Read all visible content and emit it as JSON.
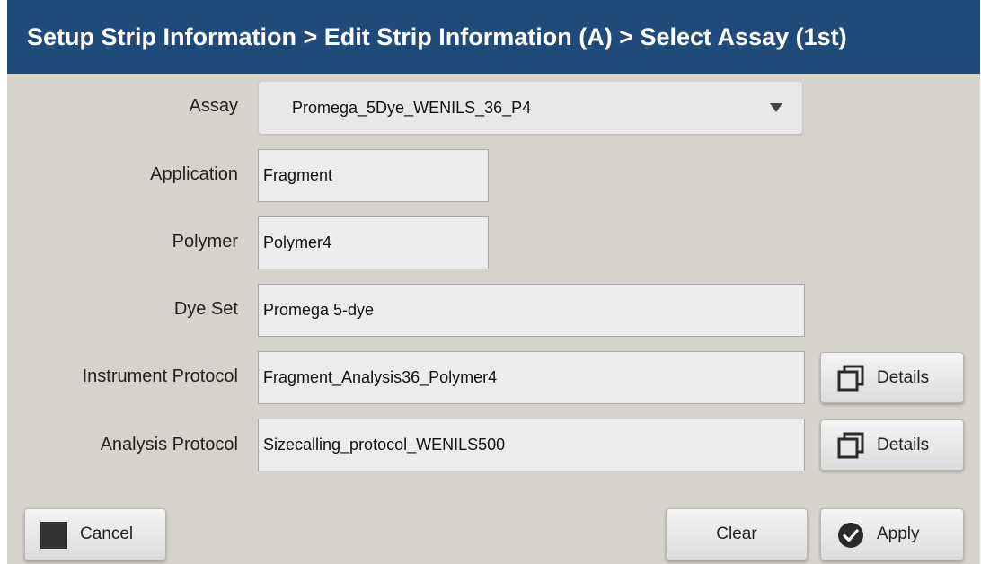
{
  "title": "Setup Strip Information > Edit Strip Information (A) > Select Assay (1st)",
  "colors": {
    "titlebar": "#1f4a7a",
    "background": "#d6d2cc"
  },
  "assay": {
    "label": "Assay",
    "value": "Promega_5Dye_WENILS_36_P4"
  },
  "application": {
    "label": "Application",
    "value": "Fragment"
  },
  "polymer": {
    "label": "Polymer",
    "value": "Polymer4"
  },
  "dye_set": {
    "label": "Dye Set",
    "value": "Promega 5-dye"
  },
  "instrument_protocol": {
    "label": "Instrument Protocol",
    "value": "Fragment_Analysis36_Polymer4",
    "details_label": "Details"
  },
  "analysis_protocol": {
    "label": "Analysis Protocol",
    "value": "Sizecalling_protocol_WENILS500",
    "details_label": "Details"
  },
  "buttons": {
    "cancel": "Cancel",
    "clear": "Clear",
    "apply": "Apply"
  },
  "icons": {
    "details": "copy-windows-icon",
    "cancel": "stop-square-icon",
    "apply": "check-circle-icon",
    "dropdown": "triangle-down-icon"
  }
}
